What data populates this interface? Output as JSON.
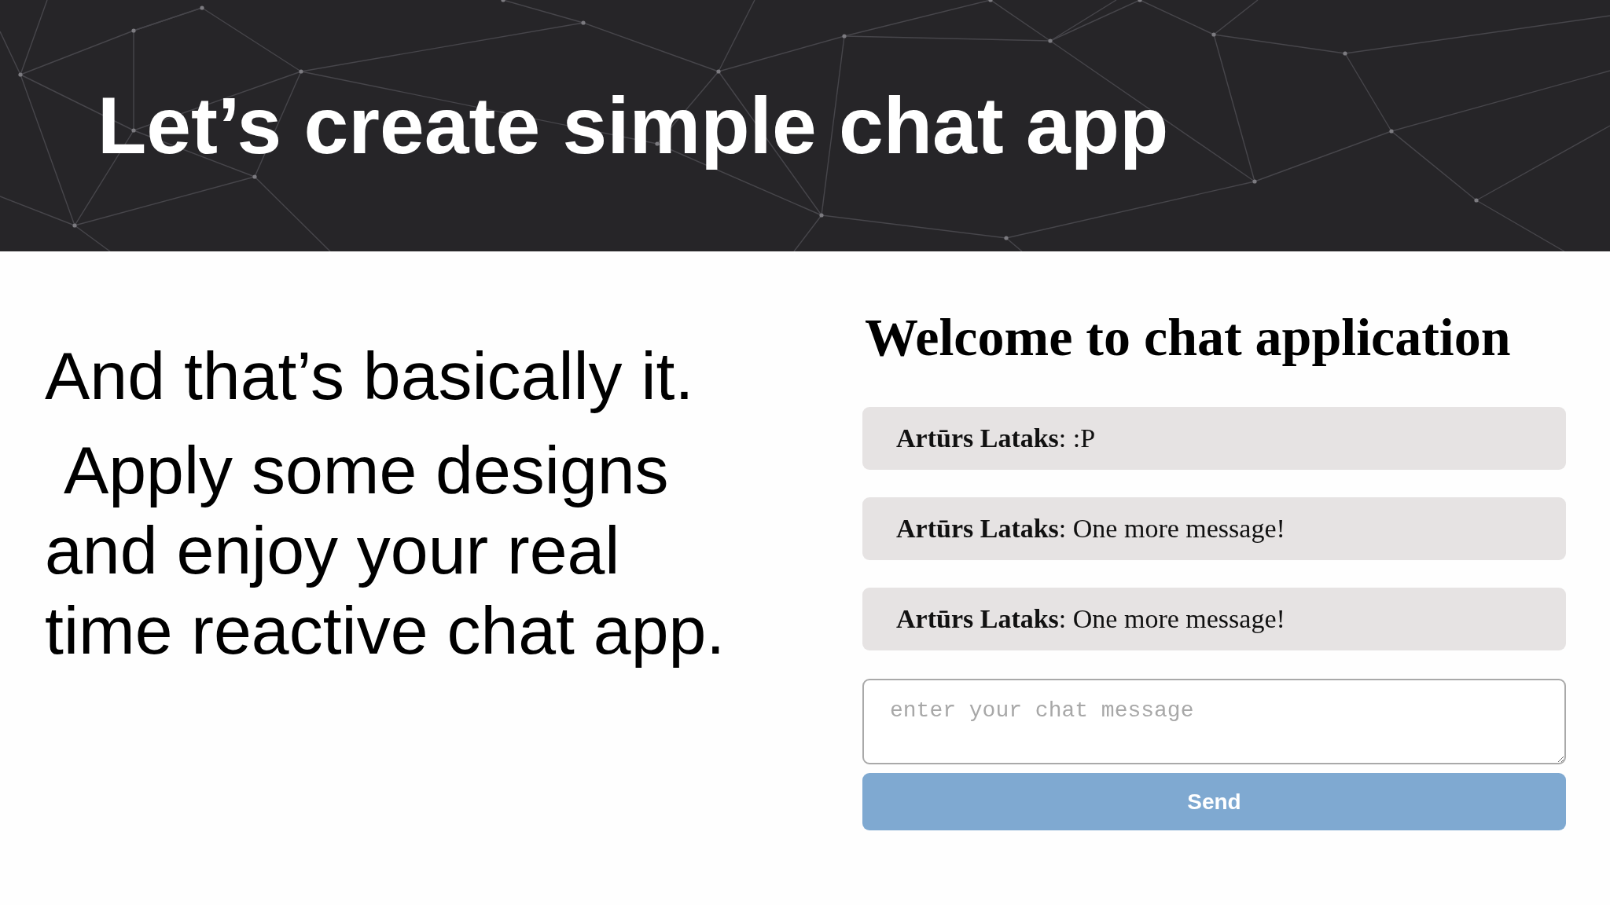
{
  "header": {
    "title": "Let’s create simple chat app"
  },
  "slide_text": {
    "paragraphs": [
      "And that’s basically it.",
      " Apply some designs and enjoy your real time reactive chat app."
    ]
  },
  "chat_app": {
    "heading": "Welcome to chat application",
    "messages": [
      {
        "text": "**Artūrs Lataks**: :P"
      },
      {
        "text": "**Artūrs Lataks**: One more message!"
      },
      {
        "text": "**Artūrs Lataks**: One more message!"
      }
    ],
    "input": {
      "placeholder": "enter your chat message"
    },
    "send_button": {
      "label": "Send"
    }
  }
}
